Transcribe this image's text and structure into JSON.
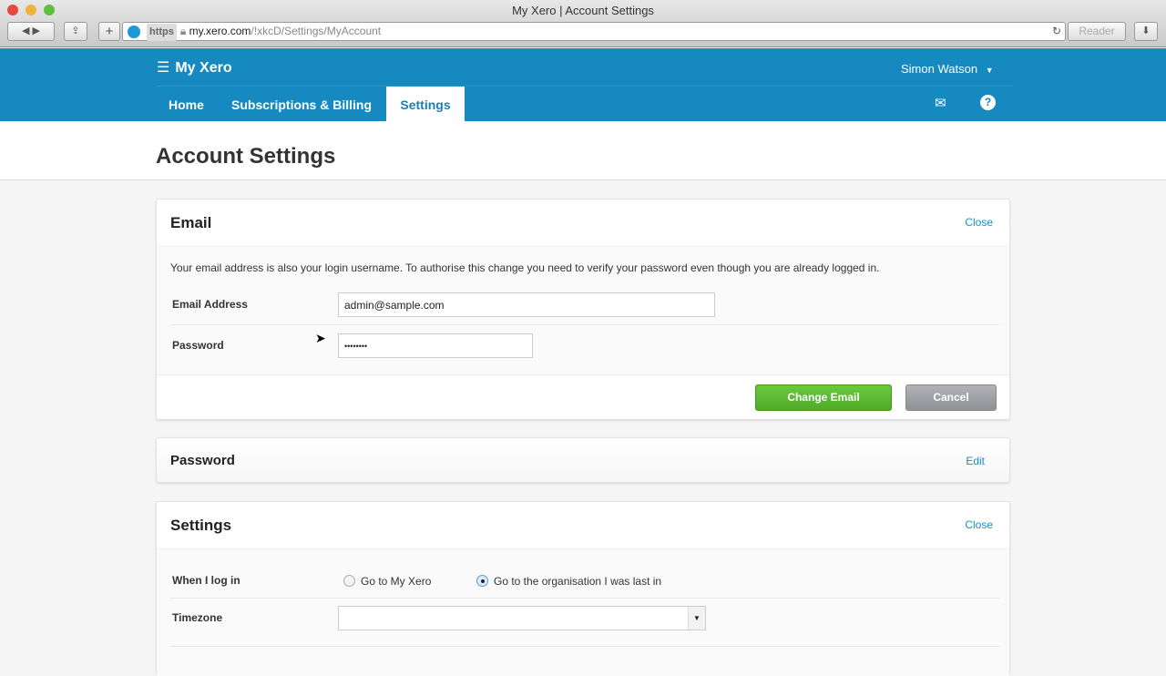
{
  "browser": {
    "title": "My Xero | Account Settings",
    "url_scheme": "https",
    "url_host": "my.xero.com",
    "url_path": "/!xkcD/Settings/MyAccount",
    "reader": "Reader"
  },
  "header": {
    "brand": "My Xero",
    "user": "Simon Watson",
    "tabs": [
      {
        "label": "Home"
      },
      {
        "label": "Subscriptions & Billing"
      },
      {
        "label": "Settings"
      }
    ]
  },
  "page": {
    "title": "Account Settings"
  },
  "email_card": {
    "title": "Email",
    "close": "Close",
    "description": "Your email address is also your login username. To authorise this change you need to verify your password even though you are already logged in.",
    "email_label": "Email Address",
    "email_value": "admin@sample.com",
    "password_label": "Password",
    "password_value": "••••••••",
    "change": "Change Email",
    "cancel": "Cancel"
  },
  "password_card": {
    "title": "Password",
    "edit": "Edit"
  },
  "settings_card": {
    "title": "Settings",
    "close": "Close",
    "login_label": "When I log in",
    "option1": "Go to My Xero",
    "option2": "Go to the organisation I was last in",
    "selected": "option2",
    "timezone_label": "Timezone",
    "timezone_value": ""
  },
  "colors": {
    "brand": "#1589c0",
    "green": "#5ab830",
    "gray": "#9a9ca0"
  }
}
